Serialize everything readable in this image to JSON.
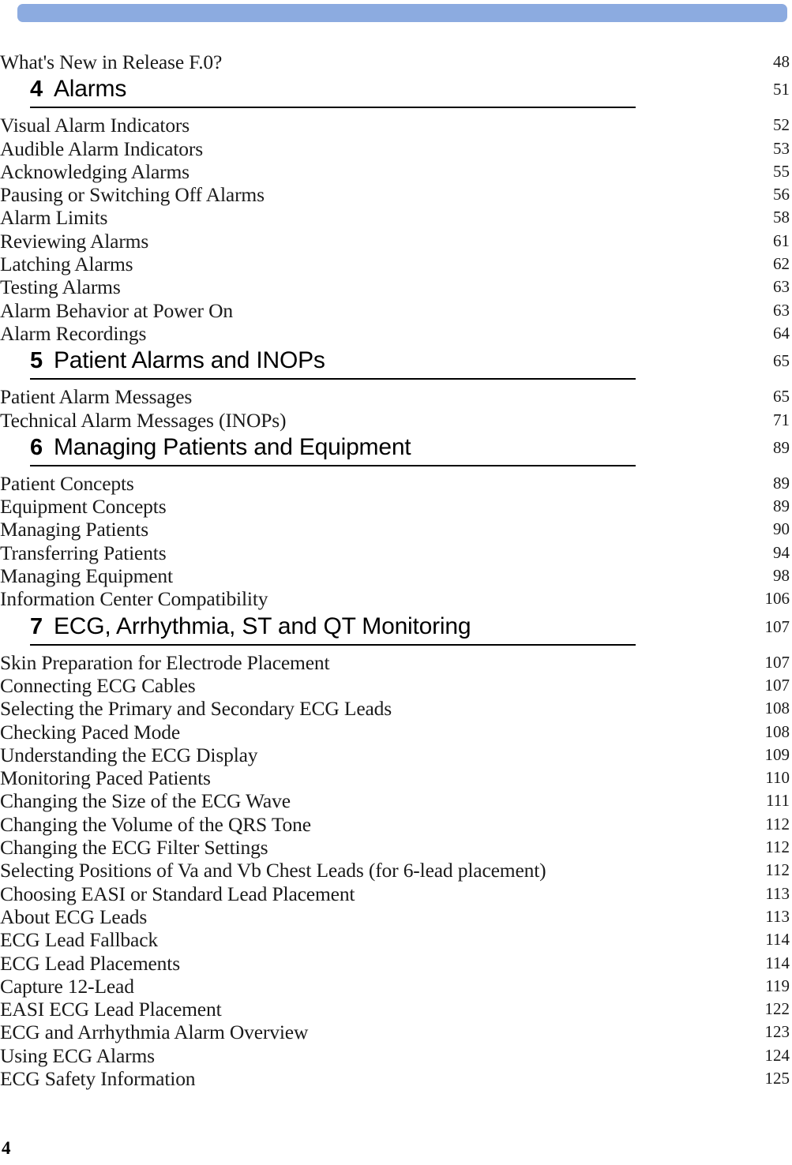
{
  "decor": {
    "top_bar_color": "#8cabe0"
  },
  "document": {
    "footer_page_number": "4"
  },
  "toc": {
    "entries": [
      {
        "type": "section",
        "label": "What's New in Release F.0?",
        "page": "48"
      },
      {
        "type": "chapter",
        "number": "4",
        "label": "Alarms",
        "page": "51"
      },
      {
        "type": "section",
        "label": "Visual Alarm Indicators",
        "page": "52"
      },
      {
        "type": "section",
        "label": "Audible Alarm Indicators",
        "page": "53"
      },
      {
        "type": "section",
        "label": "Acknowledging Alarms",
        "page": "55"
      },
      {
        "type": "section",
        "label": "Pausing or Switching Off Alarms",
        "page": "56"
      },
      {
        "type": "section",
        "label": "Alarm Limits",
        "page": "58"
      },
      {
        "type": "section",
        "label": "Reviewing Alarms",
        "page": "61"
      },
      {
        "type": "section",
        "label": "Latching Alarms",
        "page": "62"
      },
      {
        "type": "section",
        "label": "Testing Alarms",
        "page": "63"
      },
      {
        "type": "section",
        "label": "Alarm Behavior at Power On",
        "page": "63"
      },
      {
        "type": "section",
        "label": "Alarm Recordings",
        "page": "64"
      },
      {
        "type": "chapter",
        "number": "5",
        "label": "Patient Alarms and INOPs",
        "page": "65"
      },
      {
        "type": "section",
        "label": "Patient Alarm Messages",
        "page": "65"
      },
      {
        "type": "section",
        "label": "Technical Alarm Messages (INOPs)",
        "page": "71"
      },
      {
        "type": "chapter",
        "number": "6",
        "label": "Managing Patients and Equipment",
        "page": "89"
      },
      {
        "type": "section",
        "label": "Patient Concepts",
        "page": "89"
      },
      {
        "type": "section",
        "label": "Equipment Concepts",
        "page": "89"
      },
      {
        "type": "section",
        "label": "Managing Patients",
        "page": "90"
      },
      {
        "type": "section",
        "label": "Transferring Patients",
        "page": "94"
      },
      {
        "type": "section",
        "label": "Managing Equipment",
        "page": "98"
      },
      {
        "type": "section",
        "label": "Information Center Compatibility",
        "page": "106"
      },
      {
        "type": "chapter",
        "number": "7",
        "label": "ECG, Arrhythmia, ST and QT Monitoring",
        "page": "107"
      },
      {
        "type": "section",
        "label": "Skin Preparation for Electrode Placement",
        "page": "107"
      },
      {
        "type": "section",
        "label": "Connecting ECG Cables",
        "page": "107"
      },
      {
        "type": "section",
        "label": "Selecting the Primary and Secondary ECG Leads",
        "page": "108"
      },
      {
        "type": "section",
        "label": "Checking Paced Mode",
        "page": "108"
      },
      {
        "type": "section",
        "label": "Understanding the ECG Display",
        "page": "109"
      },
      {
        "type": "section",
        "label": "Monitoring Paced Patients",
        "page": "110"
      },
      {
        "type": "section",
        "label": "Changing the Size of the ECG Wave",
        "page": "111"
      },
      {
        "type": "section",
        "label": "Changing the Volume of the QRS Tone",
        "page": "112"
      },
      {
        "type": "section",
        "label": "Changing the ECG Filter Settings",
        "page": "112"
      },
      {
        "type": "section",
        "label": "Selecting Positions of Va and Vb Chest Leads (for 6-lead placement)",
        "page": "112"
      },
      {
        "type": "section",
        "label": "Choosing EASI or Standard Lead Placement",
        "page": "113"
      },
      {
        "type": "section",
        "label": "About ECG Leads",
        "page": "113"
      },
      {
        "type": "section",
        "label": "ECG Lead Fallback",
        "page": "114"
      },
      {
        "type": "section",
        "label": "ECG Lead Placements",
        "page": "114"
      },
      {
        "type": "section",
        "label": "Capture 12-Lead",
        "page": "119"
      },
      {
        "type": "section",
        "label": "EASI ECG Lead Placement",
        "page": "122"
      },
      {
        "type": "section",
        "label": "ECG and Arrhythmia Alarm Overview",
        "page": "123"
      },
      {
        "type": "section",
        "label": "Using ECG Alarms",
        "page": "124"
      },
      {
        "type": "section",
        "label": "ECG Safety Information",
        "page": "125"
      }
    ]
  }
}
